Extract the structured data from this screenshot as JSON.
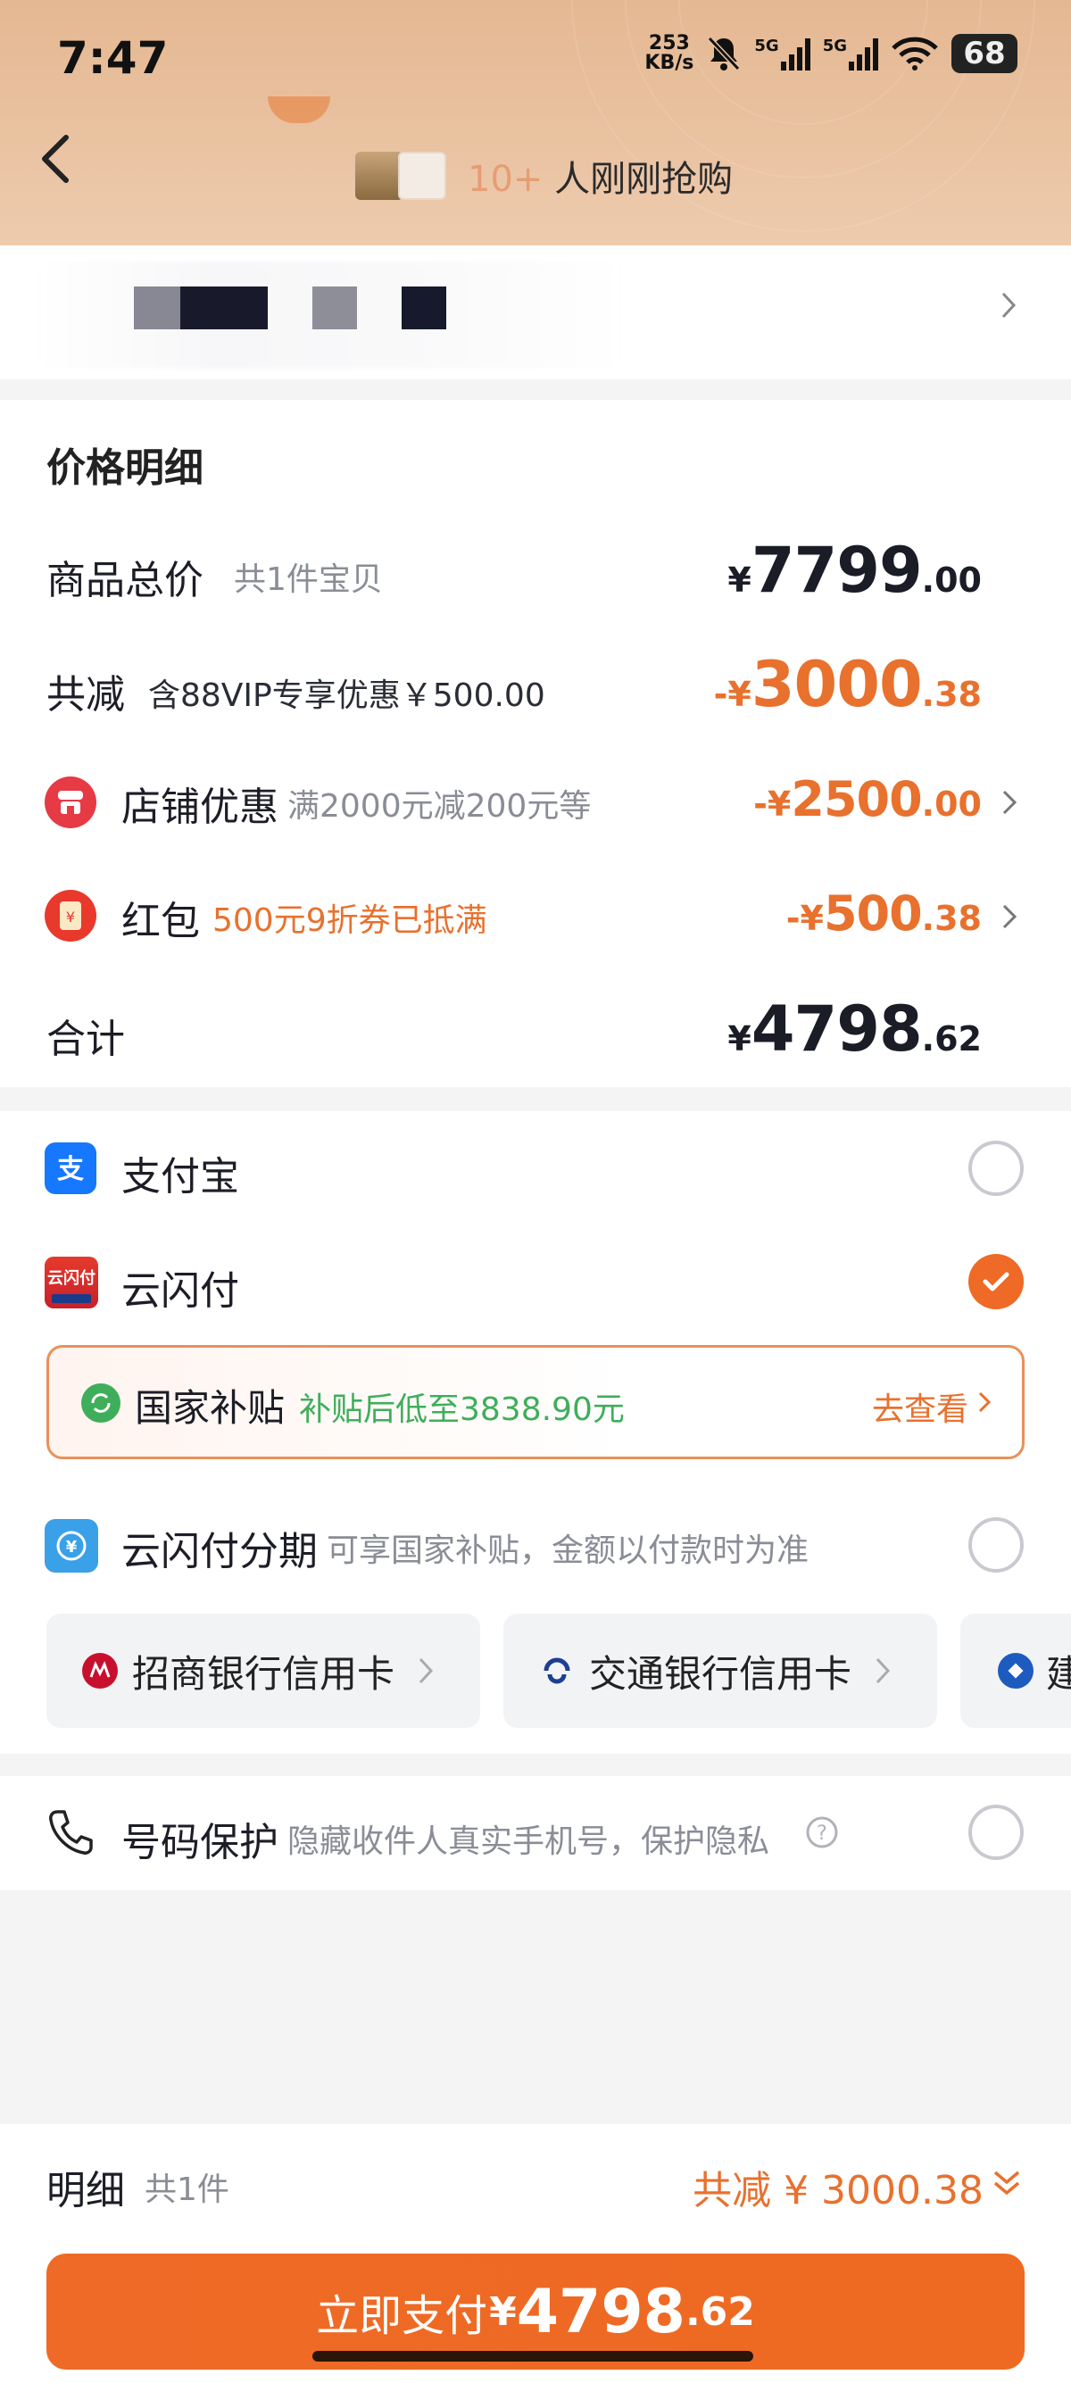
{
  "status_bar": {
    "time": "7:47",
    "net_speed_value": "253",
    "net_speed_unit": "KB/s",
    "signal1": "5G",
    "signal2": "5G",
    "battery": "68"
  },
  "header": {
    "buyers_count": "10+",
    "buyers_text": "人刚刚抢购"
  },
  "price_detail": {
    "title": "价格明细",
    "total": {
      "label": "商品总价",
      "sub": "共1件宝贝",
      "currency": "¥",
      "int": "7799",
      "dec": ".00"
    },
    "reduce": {
      "label": "共减",
      "sub": "含88VIP专享优惠￥500.00",
      "prefix": "-¥",
      "int": "3000",
      "dec": ".38"
    },
    "shop": {
      "label": "店铺优惠",
      "sub": "满2000元减200元等",
      "prefix": "-¥",
      "int": "2500",
      "dec": ".00"
    },
    "redpacket": {
      "label": "红包",
      "sub": "500元9折券已抵满",
      "prefix": "-¥",
      "int": "500",
      "dec": ".38"
    },
    "sum": {
      "label": "合计",
      "currency": "¥",
      "int": "4798",
      "dec": ".62"
    }
  },
  "payment": {
    "alipay": {
      "label": "支付宝",
      "selected": false
    },
    "unionpay": {
      "label": "云闪付",
      "logo_text": "云闪付",
      "selected": true
    },
    "subsidy": {
      "label": "国家补贴",
      "desc": "补贴后低至3838.90元",
      "link": "去查看"
    },
    "installment": {
      "label": "云闪付分期",
      "desc": "可享国家补贴，金额以付款时为准",
      "selected": false
    },
    "banks": [
      "招商银行信用卡",
      "交通银行信用卡",
      "建"
    ],
    "privacy": {
      "label": "号码保护",
      "desc": "隐藏收件人真实手机号，保护隐私",
      "selected": false
    }
  },
  "footer": {
    "detail_label": "明细",
    "detail_count": "共1件",
    "reduce_summary": "共减 ¥ 3000.38",
    "pay_label": "立即支付",
    "pay_currency": "¥",
    "pay_int": "4798",
    "pay_dec": ".62"
  },
  "colors": {
    "accent": "#ee6a26",
    "green": "#3fae5a",
    "alipay_blue": "#1677ff"
  }
}
